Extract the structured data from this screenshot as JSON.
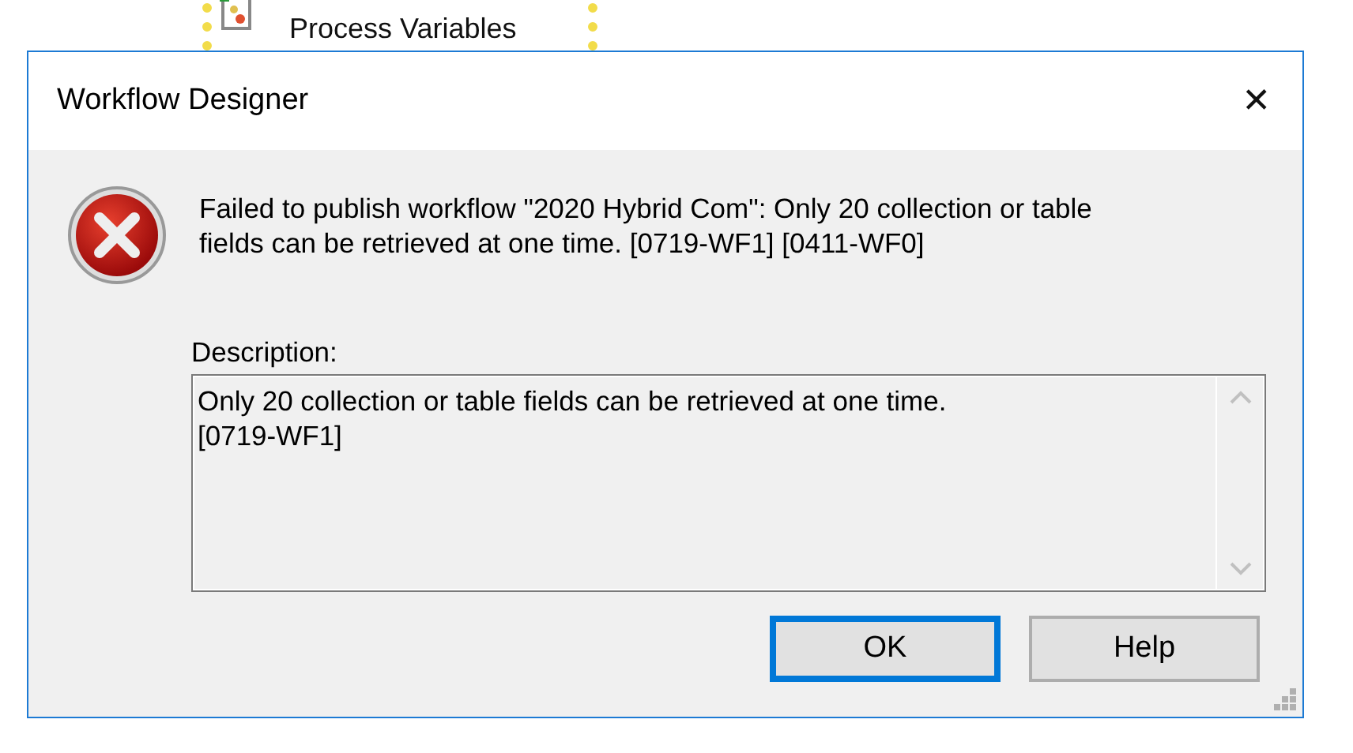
{
  "background_node": {
    "label": "Process Variables"
  },
  "window": {
    "title": "Workflow Designer",
    "close": "✕"
  },
  "message": "Failed to publish workflow \"2020 Hybrid Com\": Only 20 collection or table fields can be retrieved at one time. [0719-WF1] [0411-WF0]",
  "description": {
    "label": "Description:",
    "value": "Only 20 collection or table fields can be retrieved at one time.\n[0719-WF1]"
  },
  "buttons": [
    {
      "label": "OK",
      "default": true
    },
    {
      "label": "Help",
      "default": false
    }
  ]
}
